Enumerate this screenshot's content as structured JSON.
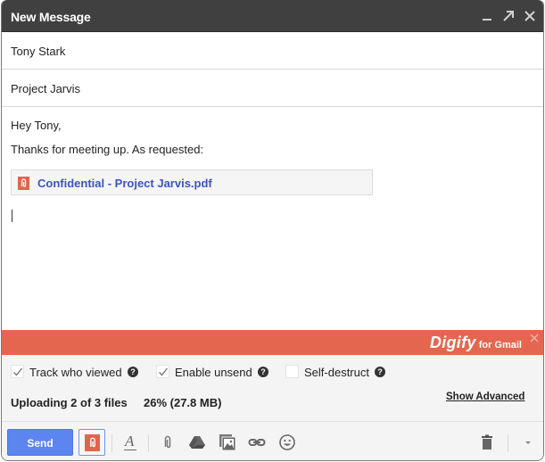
{
  "window": {
    "title": "New Message",
    "controls": {
      "minimize": "minimize-icon",
      "popout": "popout-icon",
      "close": "close-icon"
    }
  },
  "compose": {
    "to": "Tony Stark",
    "subject": "Project Jarvis",
    "body_lines": [
      "Hey Tony,",
      "Thanks for meeting up. As requested:"
    ],
    "attachment": {
      "name": "Confidential - Project Jarvis.pdf",
      "icon": "digify-clip-icon"
    }
  },
  "digify": {
    "brand": "Digify",
    "brand_suffix": "for Gmail",
    "accent_color": "#e5664f",
    "options": [
      {
        "label": "Track who viewed",
        "checked": true
      },
      {
        "label": "Enable unsend",
        "checked": true
      },
      {
        "label": "Self-destruct",
        "checked": false
      }
    ],
    "upload": {
      "status": "Uploading 2 of 3 files",
      "progress": "26% (27.8 MB)",
      "progress_percent": 26,
      "uploaded_size": "27.8 MB"
    },
    "show_advanced": "Show Advanced"
  },
  "toolbar": {
    "send_label": "Send",
    "send_color": "#5c85f0",
    "tools": [
      "digify-toggle",
      "formatting",
      "attach-files",
      "google-drive",
      "insert-photo",
      "insert-link",
      "insert-emoji",
      "discard",
      "more-options"
    ]
  }
}
